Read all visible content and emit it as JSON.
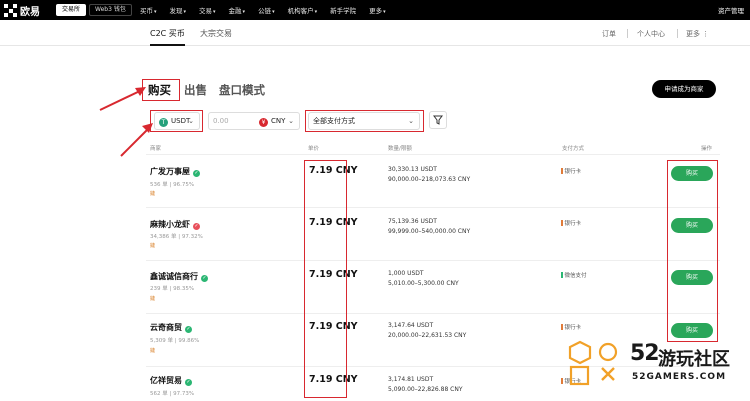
{
  "topbar": {
    "brand": "欧易",
    "mode_tabs": [
      "交易所",
      "Web3 钱包"
    ],
    "nav": [
      {
        "label": "买币",
        "has_menu": true
      },
      {
        "label": "发现",
        "has_menu": true
      },
      {
        "label": "交易",
        "has_menu": true
      },
      {
        "label": "金融",
        "has_menu": true
      },
      {
        "label": "公链",
        "has_menu": true
      },
      {
        "label": "机构客户",
        "has_menu": true
      },
      {
        "label": "新手学院",
        "has_menu": false
      },
      {
        "label": "更多",
        "has_menu": true
      }
    ],
    "assets": "资产管理"
  },
  "subnav": {
    "tabs": [
      "C2C 买币",
      "大宗交易"
    ],
    "right": [
      "订单",
      "个人中心",
      "更多"
    ]
  },
  "trade": {
    "tabs": [
      "购买",
      "出售",
      "盘口模式"
    ],
    "merchant_button": "申请成为商家",
    "crypto": {
      "code": "USDT",
      "icon_letter": "T",
      "icon_color": "#26a17b"
    },
    "amount_placeholder": "0.00",
    "fiat": {
      "code": "CNY",
      "icon_letter": "¥",
      "icon_color": "#d8282f"
    },
    "payment": "全部支付方式"
  },
  "columns": {
    "merchant": "商家",
    "price": "单价",
    "amount": "数量/限额",
    "payment": "支付方式",
    "action": "操作"
  },
  "rows": [
    {
      "name": "广发万事屋",
      "badge_color": "#2bb673",
      "orders": "536 单",
      "rate": "96.75%",
      "tag": "鏈",
      "price": "7.19 CNY",
      "quantity": "30,330.13 USDT",
      "limit": "90,000.00–218,073.63 CNY",
      "payment": "银行卡",
      "action": "购买"
    },
    {
      "name": "麻辣小龙虾",
      "badge_color": "#e8505b",
      "orders": "34,386 单",
      "rate": "97.32%",
      "tag": "鏈",
      "price": "7.19 CNY",
      "quantity": "75,139.36 USDT",
      "limit": "99,999.00–540,000.00 CNY",
      "payment": "银行卡",
      "action": "购买"
    },
    {
      "name": "鑫诚诚信商行",
      "badge_color": "#2bb673",
      "orders": "239 单",
      "rate": "98.35%",
      "tag": "鏈",
      "price": "7.19 CNY",
      "quantity": "1,000 USDT",
      "limit": "5,010.00–5,300.00 CNY",
      "payment": "微信支付",
      "action": "购买"
    },
    {
      "name": "云奇商贸",
      "badge_color": "#2bb673",
      "orders": "5,309 单",
      "rate": "99.86%",
      "tag": "鏈",
      "price": "7.19 CNY",
      "quantity": "3,147.64 USDT",
      "limit": "20,000.00–22,631.53 CNY",
      "payment": "银行卡",
      "action": "购买"
    },
    {
      "name": "亿祥贸易",
      "badge_color": "#2bb673",
      "orders": "562 单",
      "rate": "97.73%",
      "tag": "",
      "price": "7.19 CNY",
      "quantity": "3,174.81 USDT",
      "limit": "5,090.00–22,826.88 CNY",
      "payment": "银行卡",
      "action": ""
    }
  ],
  "watermark": {
    "number": "52",
    "text": "游玩社区",
    "sub": "52GAMERS.COM"
  }
}
